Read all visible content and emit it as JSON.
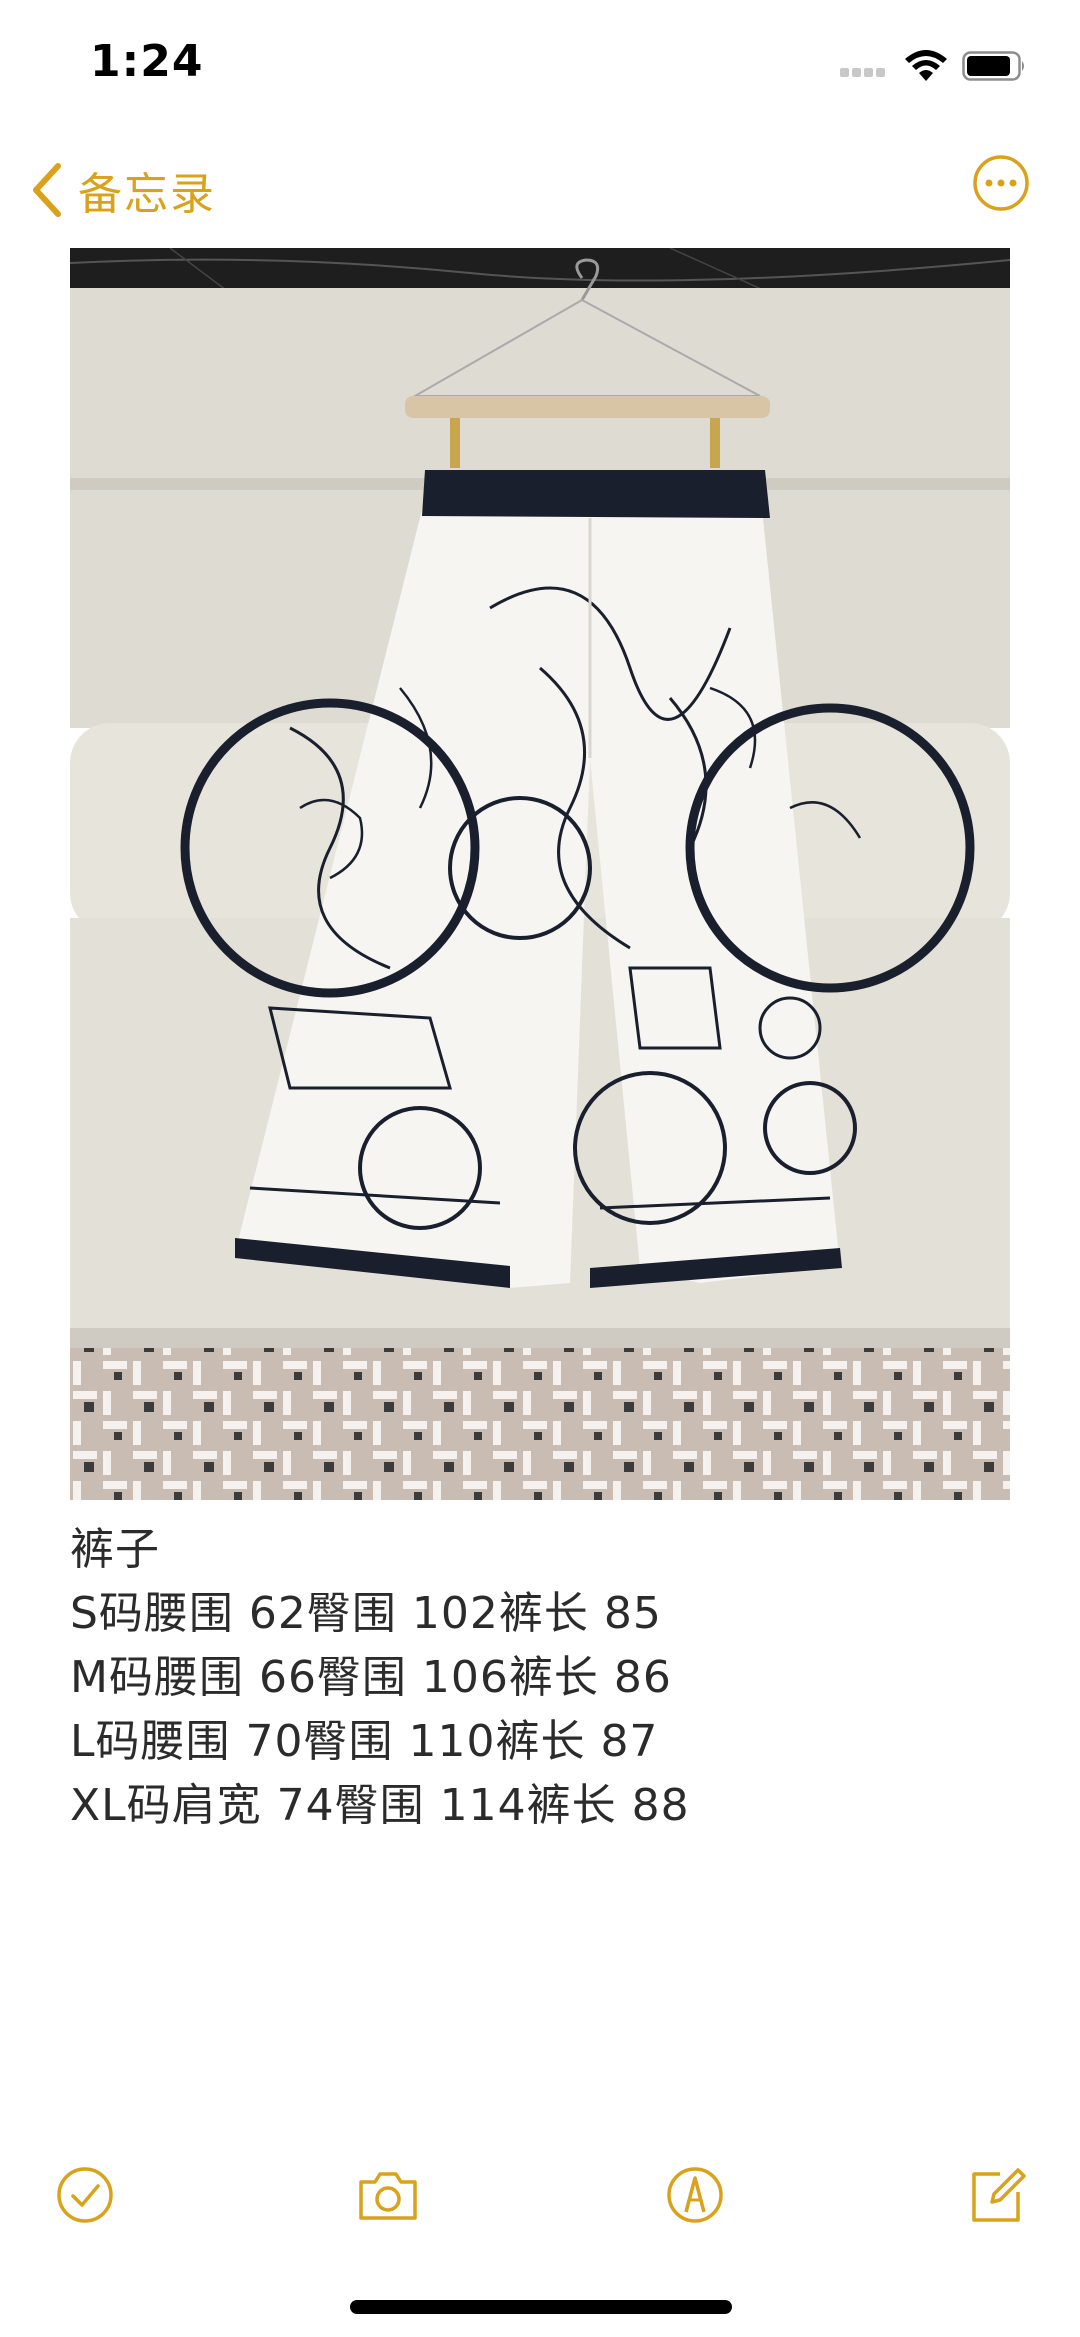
{
  "status_bar": {
    "time": "1:24",
    "icons": [
      "cellular-signal-icon",
      "wifi-icon",
      "battery-icon"
    ]
  },
  "nav": {
    "back_label": "备忘录",
    "back_icon": "chevron-left-icon",
    "more_icon": "ellipsis-circle-icon",
    "accent_color": "#D9A21A"
  },
  "note": {
    "image_description_icon": "photo-attachment",
    "lines": [
      "裤子",
      "S码腰围 62臀围 102裤长 85",
      "M码腰围 66臀围 106裤长 86",
      "L码腰围 70臀围 110裤长 87",
      "XL码肩宽 74臀围 114裤长 88"
    ]
  },
  "toolbar": {
    "icons": [
      "checklist-icon",
      "camera-icon",
      "markup-pen-icon",
      "compose-icon"
    ]
  }
}
